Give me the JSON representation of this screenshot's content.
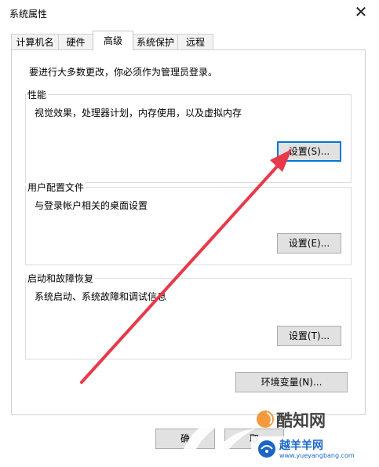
{
  "window": {
    "title": "系统属性",
    "close_glyph": "✕"
  },
  "tabs": [
    {
      "label": "计算机名"
    },
    {
      "label": "硬件"
    },
    {
      "label": "高级"
    },
    {
      "label": "系统保护"
    },
    {
      "label": "远程"
    }
  ],
  "panel": {
    "note": "要进行大多数更改，你必须作为管理员登录。"
  },
  "performance": {
    "label": "性能",
    "desc": "视觉效果，处理器计划，内存使用，以及虚拟内存",
    "button": "设置(S)..."
  },
  "profiles": {
    "label": "用户配置文件",
    "desc": "与登录帐户相关的桌面设置",
    "button": "设置(E)..."
  },
  "startup": {
    "label": "启动和故障恢复",
    "desc": "系统启动、系统故障和调试信息",
    "button": "设置(T)..."
  },
  "env_button": "环境变量(N)...",
  "bottom_buttons": {
    "ok": "确",
    "cancel": "取"
  },
  "watermarks": {
    "left": "酷知网",
    "brand": "越羊羊网",
    "url": "www.yueyangbang.com"
  },
  "colors": {
    "arrow": "#e8394a",
    "focus": "#0078d7",
    "watermark_orange": "#f08a1c",
    "watermark_blue": "#1a66c8"
  }
}
